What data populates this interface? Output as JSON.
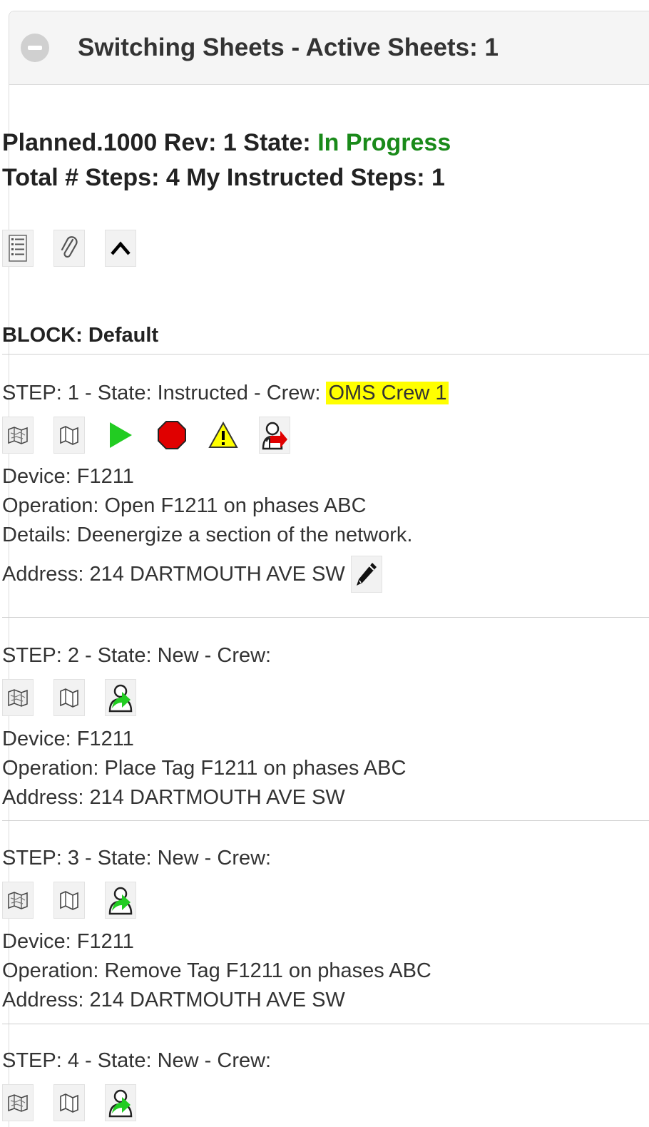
{
  "panel": {
    "title": "Switching Sheets - Active Sheets: 1"
  },
  "sheet": {
    "name_rev_label": "Planned.1000 Rev: 1 State: ",
    "state": "In Progress",
    "steps_label": "Total # Steps: 4 My Instructed Steps: 1"
  },
  "toolbar": {
    "icons": [
      "list-icon",
      "paperclip-icon",
      "chevron-up-icon"
    ]
  },
  "block": {
    "label": "BLOCK",
    "name": ": Default"
  },
  "steps": [
    {
      "title": "STEP: 1 - State: Instructed - Crew: ",
      "crew": "OMS Crew 1",
      "device": "Device: F1211",
      "operation": "Operation: Open F1211 on phases ABC",
      "details": "Details: Deenergize a section of the network.",
      "address": "Address: 214 DARTMOUTH AVE SW",
      "icons": [
        "map-icon",
        "map-fold-icon",
        "play-icon",
        "stop-icon",
        "warning-icon",
        "crew-unassign-icon"
      ]
    },
    {
      "title": "STEP: 2 - State: New - Crew:",
      "device": "Device: F1211",
      "operation": "Operation: Place Tag F1211 on phases ABC",
      "address": "Address: 214 DARTMOUTH AVE SW",
      "icons": [
        "map-icon",
        "map-fold-icon",
        "crew-assign-icon"
      ]
    },
    {
      "title": "STEP: 3 - State: New - Crew:",
      "device": "Device: F1211",
      "operation": "Operation: Remove Tag F1211 on phases ABC",
      "address": "Address: 214 DARTMOUTH AVE SW",
      "icons": [
        "map-icon",
        "map-fold-icon",
        "crew-assign-icon"
      ]
    },
    {
      "title": "STEP: 4 - State: New - Crew:",
      "icons": [
        "map-icon",
        "map-fold-icon",
        "crew-assign-icon"
      ]
    }
  ],
  "colors": {
    "state_green": "#1a8a1a",
    "crew_highlight": "#ffff00",
    "play_green": "#22cc22",
    "stop_red": "#e00000",
    "warning_yellow": "#ffff00"
  }
}
